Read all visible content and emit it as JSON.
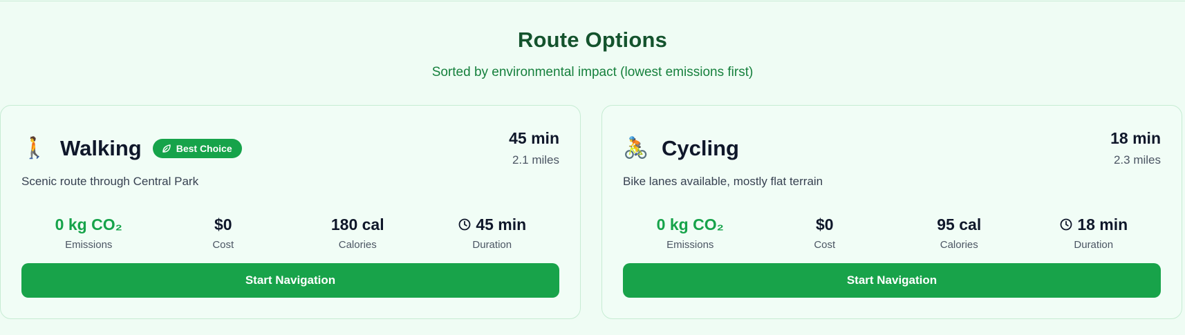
{
  "header": {
    "title": "Route Options",
    "subtitle": "Sorted by environmental impact (lowest emissions first)"
  },
  "colors": {
    "accent": "#16a34a",
    "title": "#14532d",
    "background": "#effcf4"
  },
  "routes": [
    {
      "mode": "Walking",
      "icon": "🚶",
      "icon_name": "walking-person-icon",
      "badge": "Best Choice",
      "badge_icon": "leaf-icon",
      "time": "45 min",
      "distance": "2.1 miles",
      "description": "Scenic route through Central Park",
      "stats": {
        "emissions_value": "0 kg CO₂",
        "emissions_label": "Emissions",
        "cost_value": "$0",
        "cost_label": "Cost",
        "calories_value": "180 cal",
        "calories_label": "Calories",
        "duration_value": "45 min",
        "duration_label": "Duration"
      },
      "button": "Start Navigation"
    },
    {
      "mode": "Cycling",
      "icon": "🚴",
      "icon_name": "cyclist-icon",
      "time": "18 min",
      "distance": "2.3 miles",
      "description": "Bike lanes available, mostly flat terrain",
      "stats": {
        "emissions_value": "0 kg CO₂",
        "emissions_label": "Emissions",
        "cost_value": "$0",
        "cost_label": "Cost",
        "calories_value": "95 cal",
        "calories_label": "Calories",
        "duration_value": "18 min",
        "duration_label": "Duration"
      },
      "button": "Start Navigation"
    }
  ]
}
